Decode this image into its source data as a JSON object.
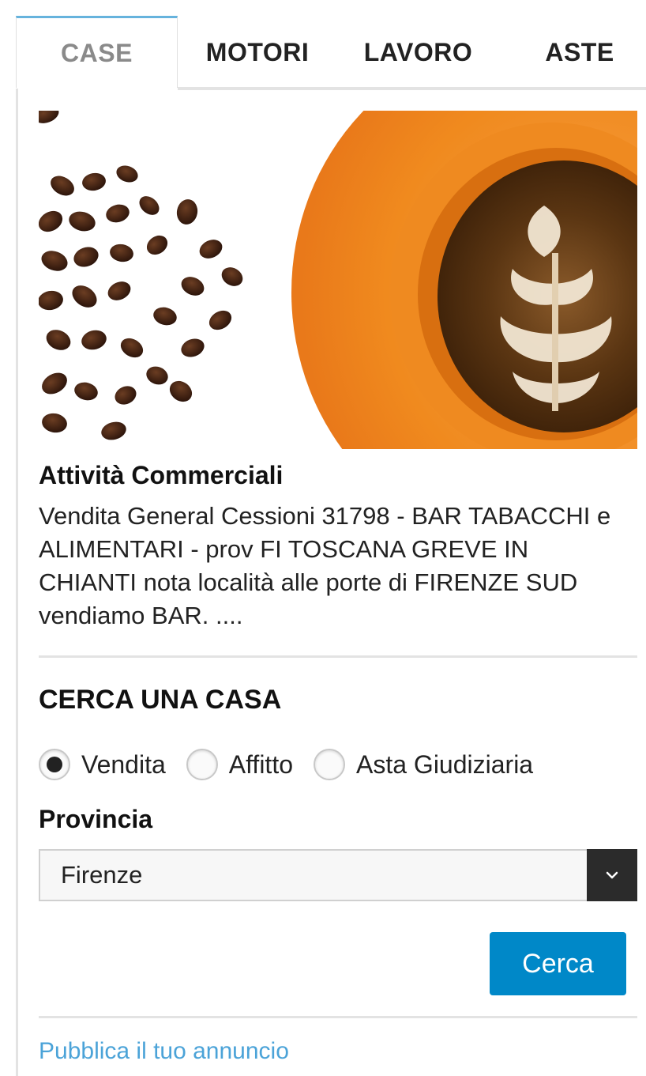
{
  "tabs": [
    {
      "label": "CASE",
      "active": true
    },
    {
      "label": "MOTORI",
      "active": false
    },
    {
      "label": "LAVORO",
      "active": false
    },
    {
      "label": "ASTE",
      "active": false
    }
  ],
  "hero": {
    "image": "coffee-beans-and-latte-art-cup"
  },
  "listing": {
    "category": "Attività Commerciali",
    "description": "Vendita General Cessioni 31798 - BAR TABACCHI e ALIMENTARI - prov FI TOSCANA GREVE IN CHIANTI nota località alle porte di FIRENZE SUD vendiamo BAR. ...."
  },
  "search": {
    "title": "CERCA UNA CASA",
    "options": [
      {
        "label": "Vendita",
        "selected": true
      },
      {
        "label": "Affitto",
        "selected": false
      },
      {
        "label": "Asta Giudiziaria",
        "selected": false
      }
    ],
    "province_label": "Provincia",
    "province_value": "Firenze",
    "button_label": "Cerca"
  },
  "footer": {
    "publish_link": "Pubblica il tuo annuncio"
  },
  "colors": {
    "accent": "#0088c8",
    "link": "#4ba3d8",
    "tab_active_border": "#66b3dd",
    "select_arrow_bg": "#2b2b2b"
  }
}
